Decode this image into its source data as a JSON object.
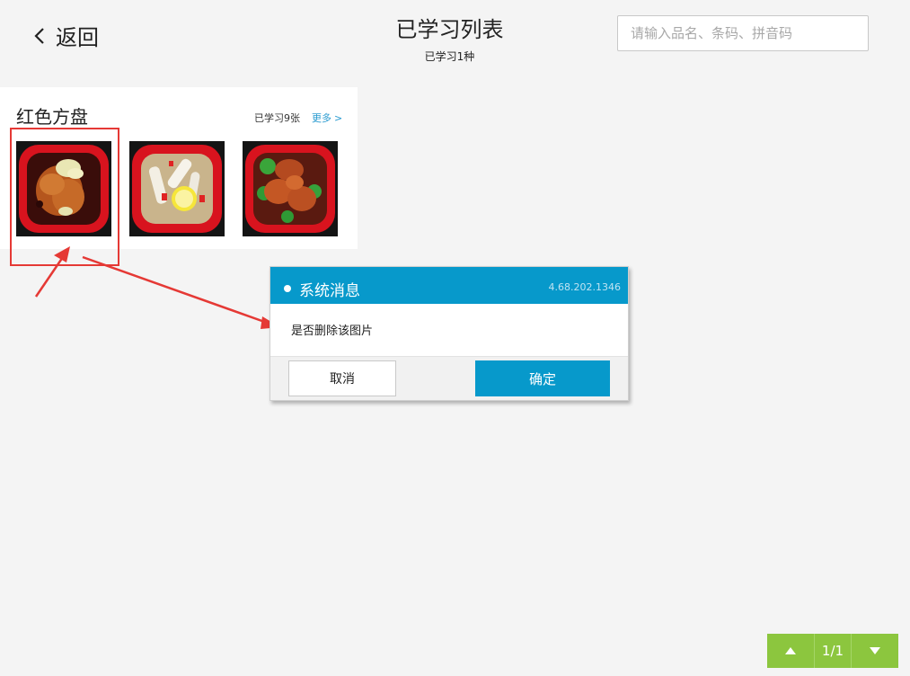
{
  "header": {
    "back_label": "返回",
    "title": "已学习列表",
    "subtitle": "已学习1种"
  },
  "search": {
    "placeholder": "请输入品名、条码、拼音码",
    "value": ""
  },
  "card": {
    "title": "红色方盘",
    "count_text": "已学习9张",
    "more_label": "更多",
    "more_chevron": ">",
    "images": [
      {
        "name": "braised-meat-dish"
      },
      {
        "name": "lemon-fruit-salad"
      },
      {
        "name": "broccoli-meat-dish"
      }
    ]
  },
  "dialog": {
    "title": "系统消息",
    "version": "4.68.202.1346",
    "message": "是否删除该图片",
    "cancel_label": "取消",
    "confirm_label": "确定"
  },
  "pager": {
    "label": "1/1",
    "up_icon": "triangle-up-icon",
    "down_icon": "triangle-down-icon"
  },
  "colors": {
    "accent": "#0799cb",
    "pager_green": "#8cc63e",
    "annotation_red": "#e53935",
    "tray_red": "#d8131e"
  }
}
